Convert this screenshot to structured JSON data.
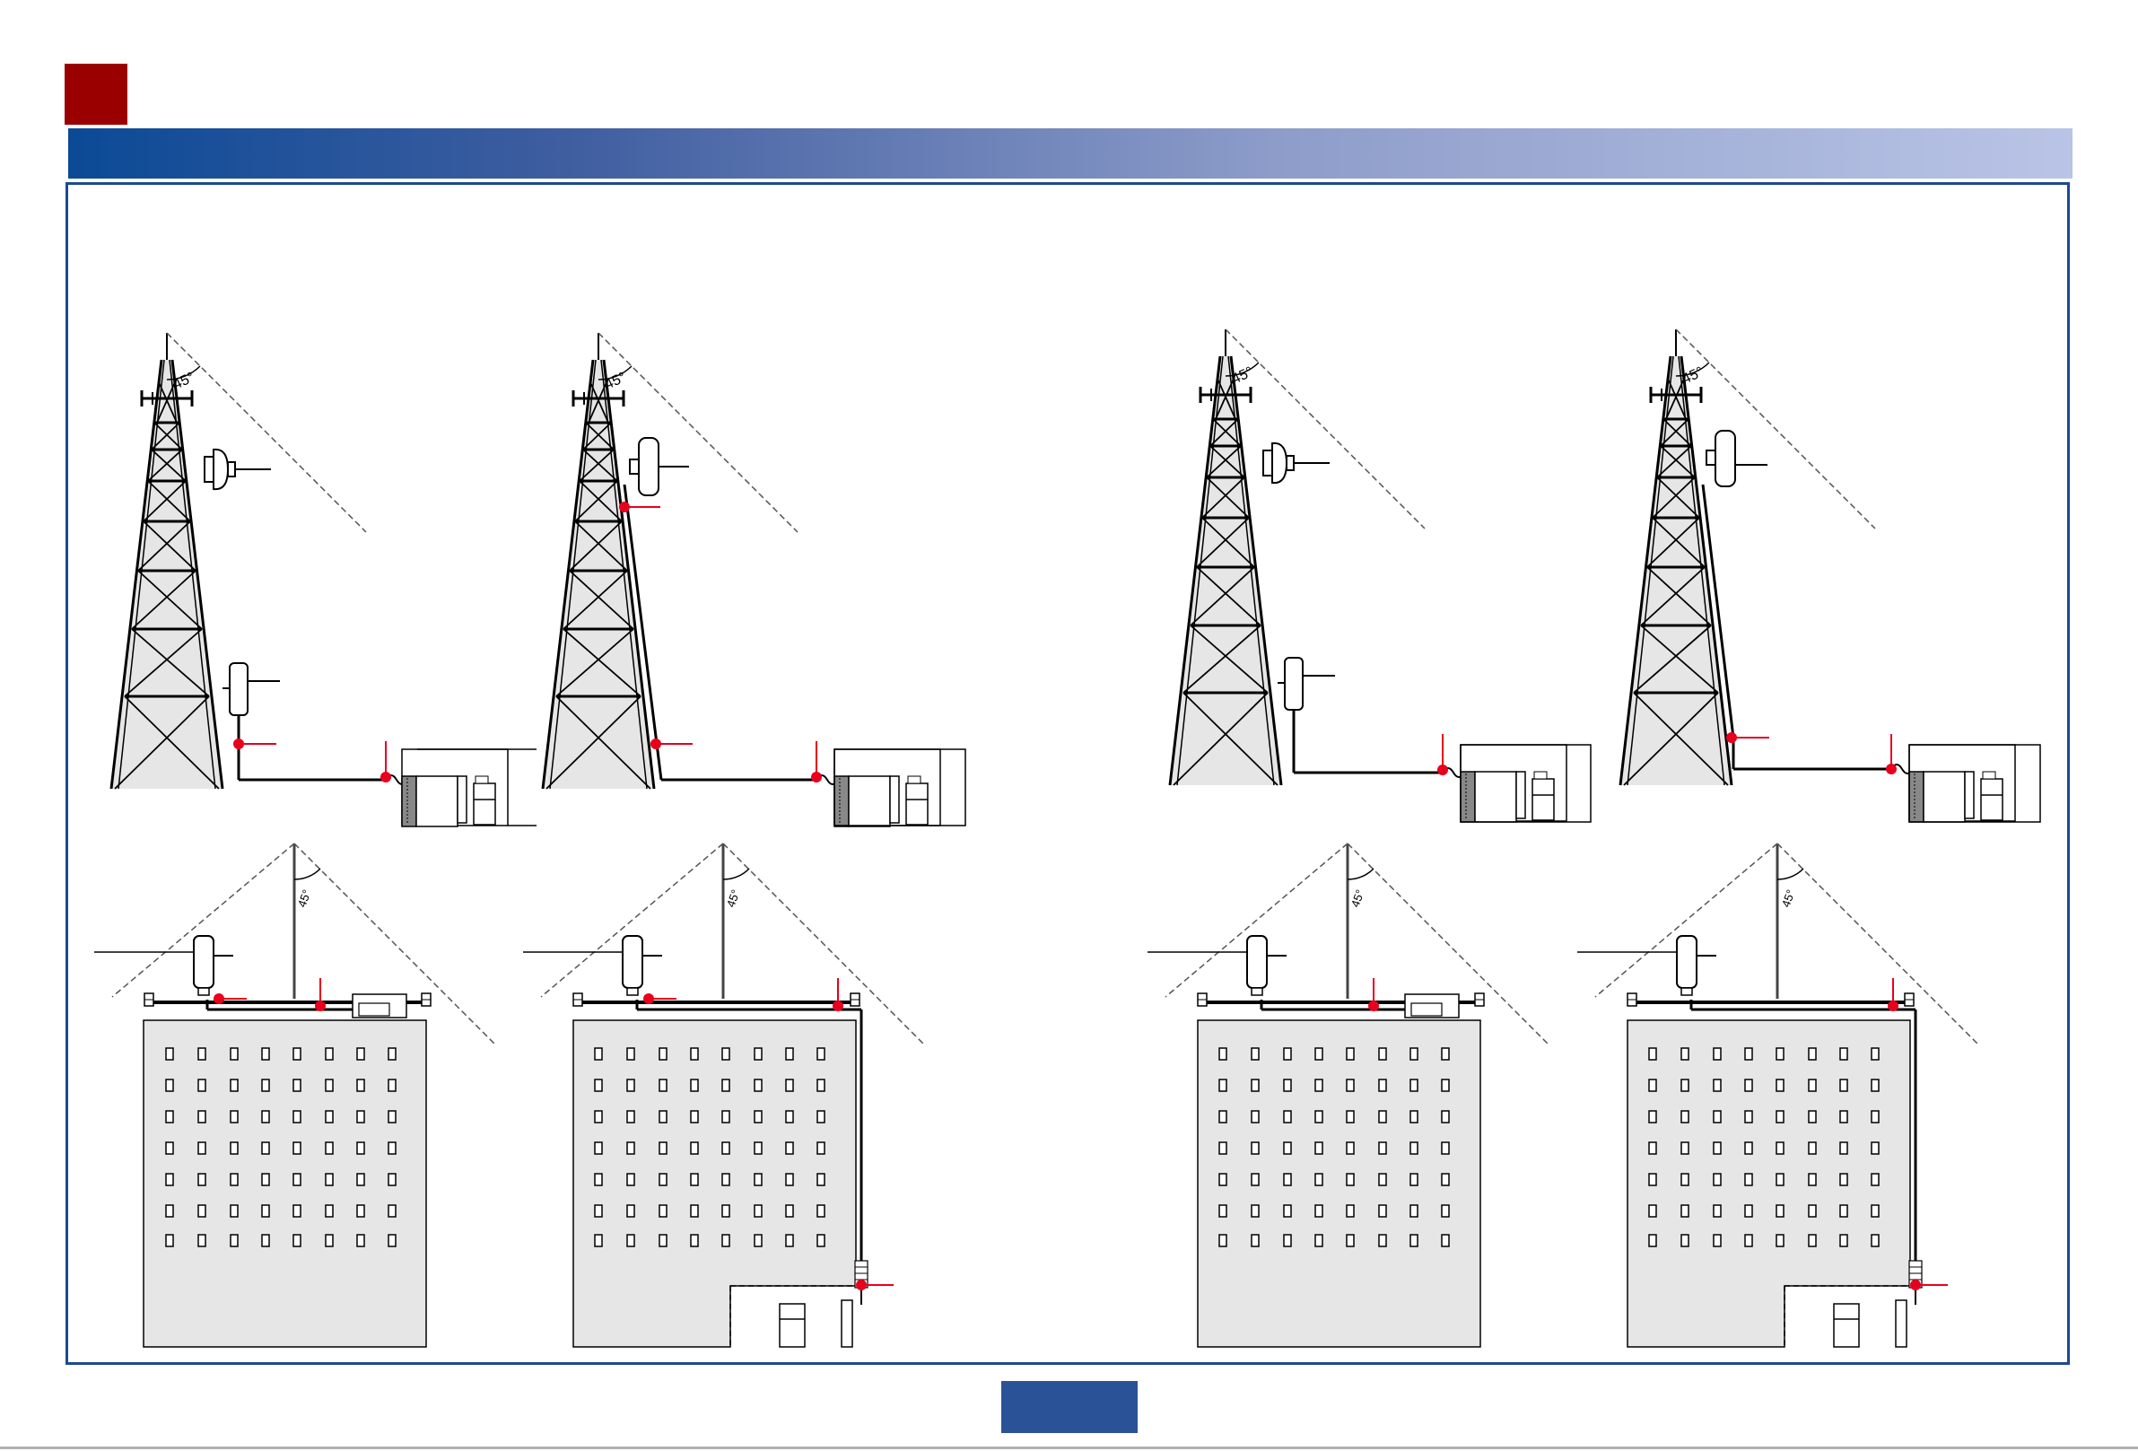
{
  "colors": {
    "title_square": "#9b0000",
    "title_bar_start": "#0b4a96",
    "title_bar_end": "#b9c4e6",
    "frame": "#1d4a8f",
    "ground_point": "#e8001c",
    "building_fill": "#e6e6e6"
  },
  "angle_label": "45°",
  "page_badge": "",
  "panels": [
    {
      "kind": "tower",
      "variant": "split_mount",
      "ground_points": 2
    },
    {
      "kind": "tower",
      "variant": "full_outdoor",
      "ground_points": 3
    },
    {
      "kind": "tower",
      "variant": "split_mount_no_tower_ground",
      "ground_points": 1
    },
    {
      "kind": "tower",
      "variant": "full_outdoor_single",
      "ground_points": 2
    },
    {
      "kind": "building",
      "variant": "rooftop_indoor_unit",
      "ground_points": 2
    },
    {
      "kind": "building",
      "variant": "cable_down_to_basement",
      "ground_points": 3
    },
    {
      "kind": "building",
      "variant": "rooftop_indoor_unit",
      "ground_points": 1
    },
    {
      "kind": "building",
      "variant": "cable_down_to_basement",
      "ground_points": 2
    }
  ]
}
